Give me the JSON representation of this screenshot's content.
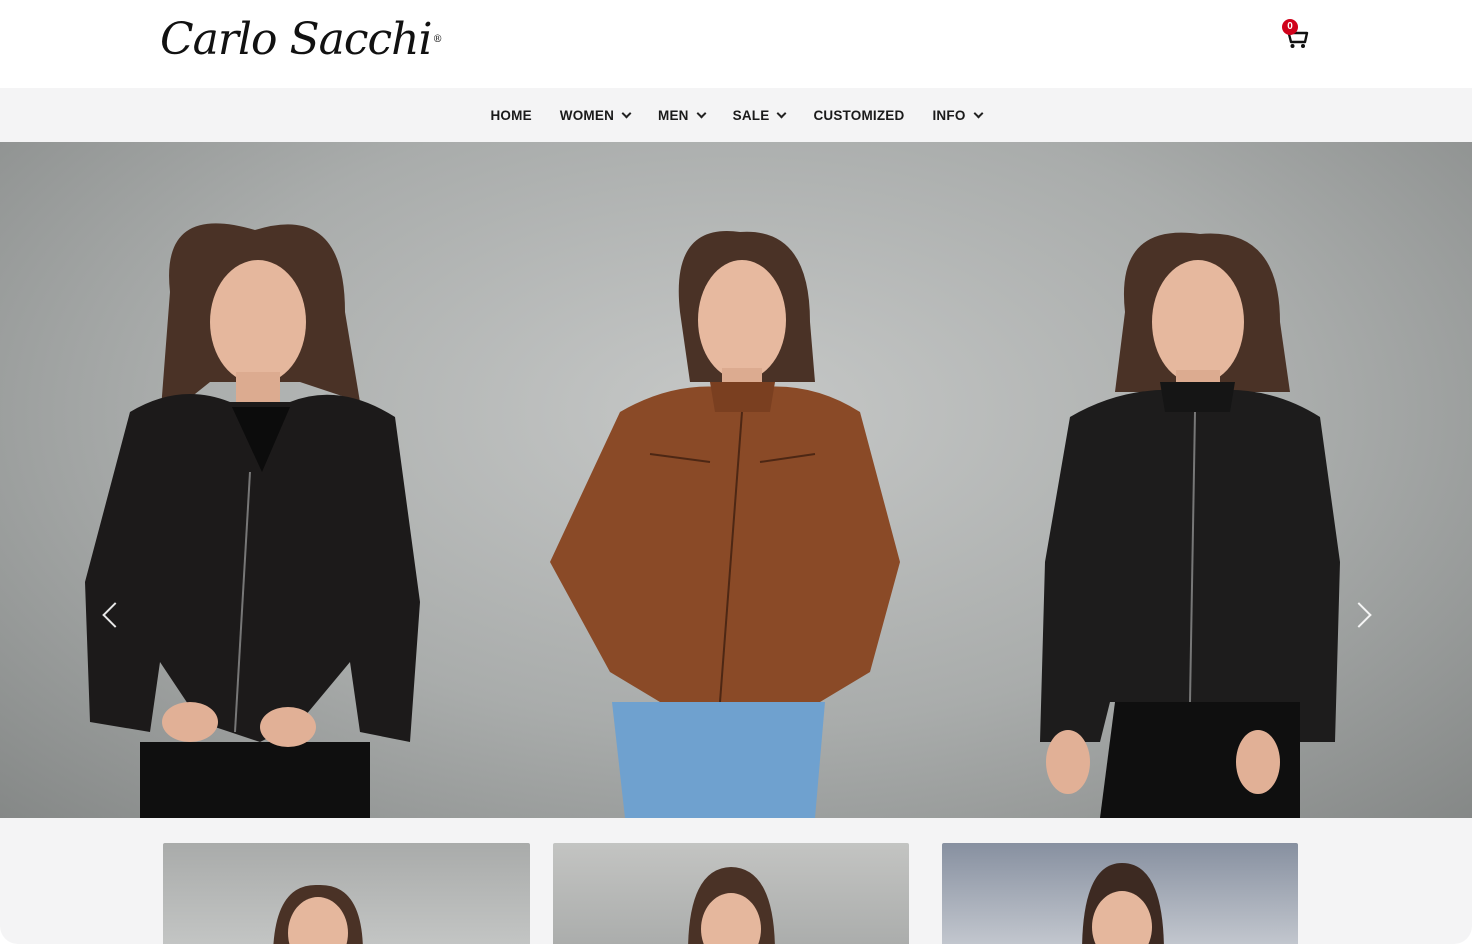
{
  "header": {
    "logo_text": "Carlo Sacchi",
    "logo_mark": "®",
    "cart_count": "0",
    "cart_icon": "shopping-cart-icon"
  },
  "nav": {
    "items": [
      {
        "label": "HOME",
        "dropdown": false
      },
      {
        "label": "WOMEN",
        "dropdown": true
      },
      {
        "label": "MEN",
        "dropdown": true
      },
      {
        "label": "SALE",
        "dropdown": true
      },
      {
        "label": "CUSTOMIZED",
        "dropdown": false
      },
      {
        "label": "INFO",
        "dropdown": true
      }
    ]
  },
  "hero": {
    "slides_shown": [
      "black leather biker jacket",
      "brown leather racer jacket",
      "black leather racer jacket"
    ],
    "prev_icon": "chevron-left-icon",
    "next_icon": "chevron-right-icon"
  },
  "thumbnails": {
    "count": 3
  },
  "colors": {
    "accent_badge": "#d0021b",
    "nav_bg": "#f4f4f5",
    "text": "#1a1a1a"
  }
}
